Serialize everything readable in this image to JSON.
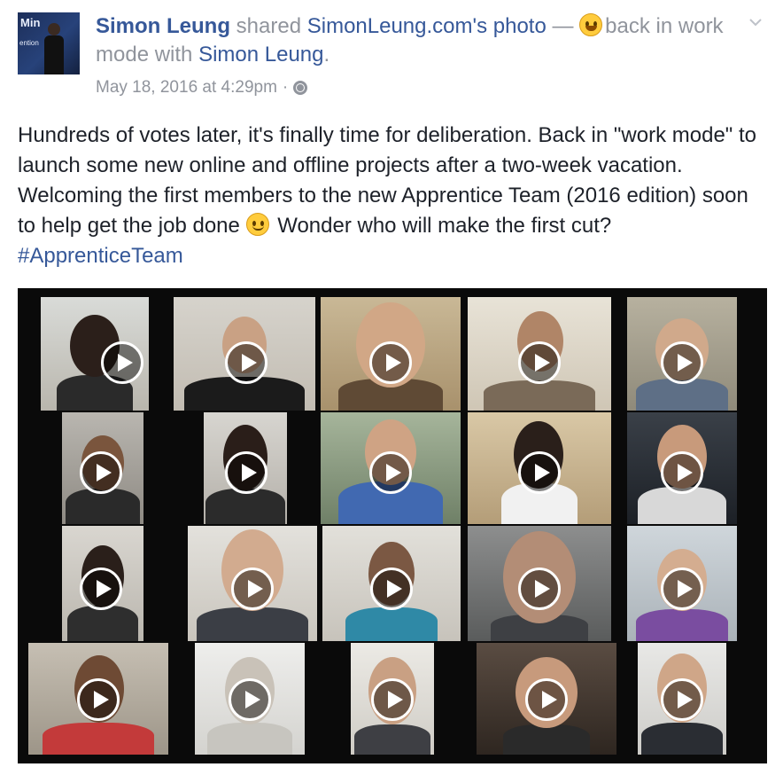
{
  "post": {
    "avatar_text_1": "Min",
    "avatar_text_2": "ention",
    "author": "Simon Leung",
    "shared_word": "shared",
    "source_page": "SimonLeung.com's",
    "photo_word": "photo",
    "dash": "—",
    "activity": "back in work mode with",
    "tagged": "Simon Leung",
    "period": ".",
    "timestamp": "May 18, 2016 at 4:29pm",
    "dot": "·",
    "body_text": "Hundreds of votes later, it's finally time for deliberation. Back in \"work mode\" to launch some new online and offline projects after a two-week vacation. Welcoming the first members to the new Apprentice Team (2016 edition) soon to help get the job done",
    "body_text_2": "Wonder who will make the first cut?",
    "hashtag": "#ApprenticeTeam"
  },
  "icons": {
    "emoji_feeling": "grinning-face-icon",
    "emoji_smile": "slightly-smiling-face-icon",
    "privacy": "globe-icon",
    "options": "chevron-down-icon",
    "play": "play-icon"
  },
  "colors": {
    "link": "#365899",
    "meta_gray": "#90949c",
    "text": "#1d2129"
  }
}
